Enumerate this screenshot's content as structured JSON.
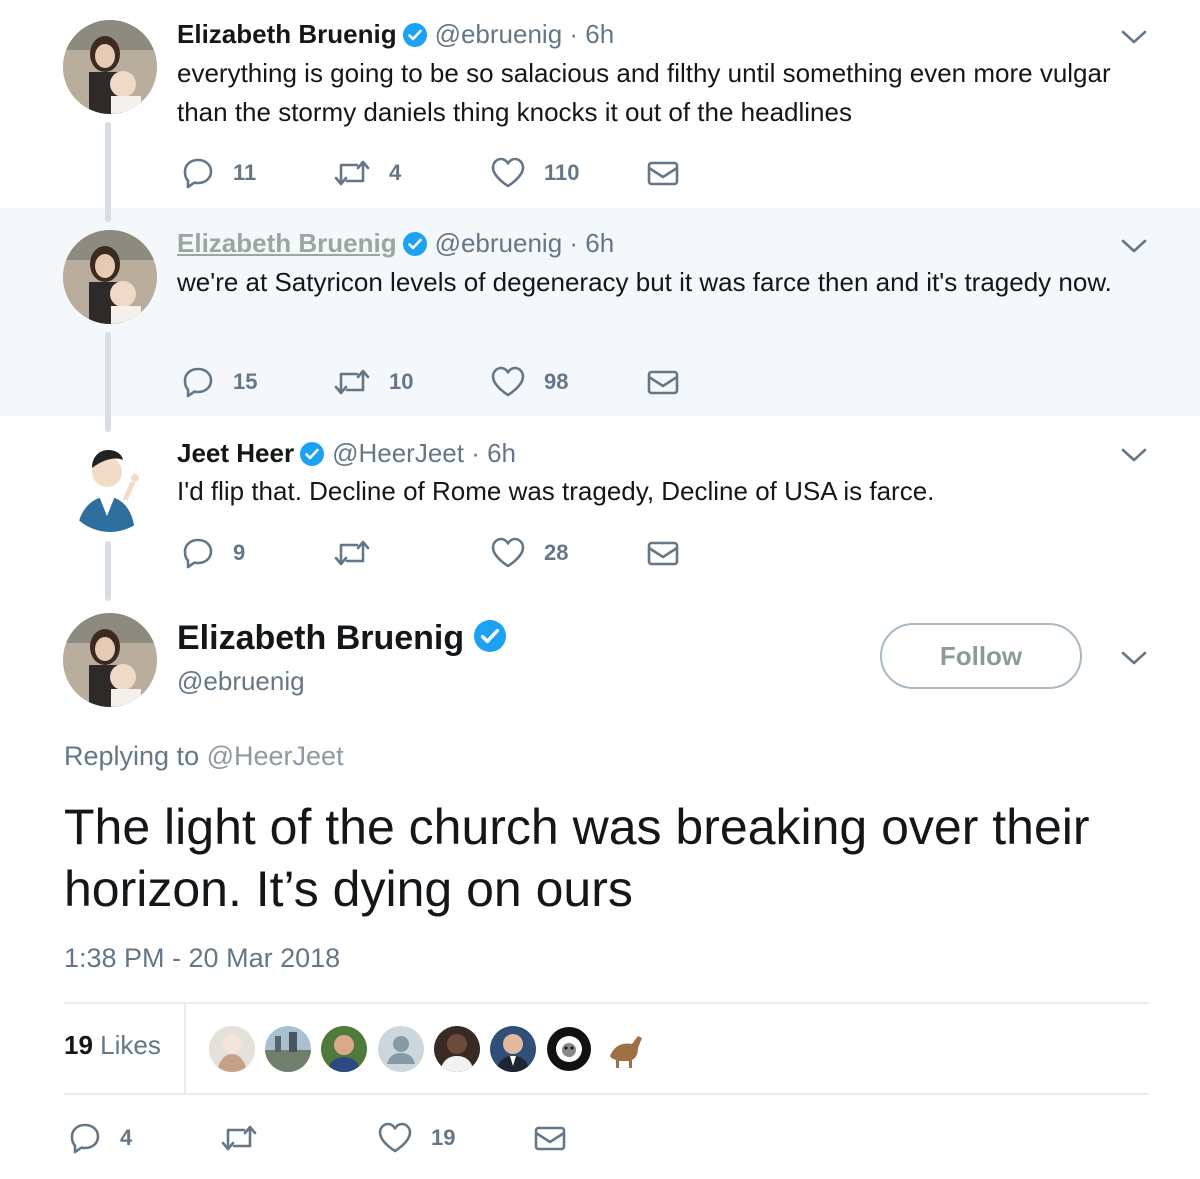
{
  "tweets": [
    {
      "name": "Elizabeth Bruenig",
      "handle": "@ebruenig",
      "time": "· 6h",
      "text": "everything is going to be so salacious and filthy until something even more vulgar than the stormy daniels thing knocks it out of the headlines",
      "replies": "11",
      "retweets": "4",
      "likes": "110"
    },
    {
      "name": "Elizabeth Bruenig",
      "handle": "@ebruenig",
      "time": "· 6h",
      "text": "we're at Satyricon levels of degeneracy but it was farce then and it's tragedy now.",
      "replies": "15",
      "retweets": "10",
      "likes": "98"
    },
    {
      "name": "Jeet Heer",
      "handle": "@HeerJeet",
      "time": "· 6h",
      "text": "I'd flip that. Decline of Rome was tragedy, Decline of USA is farce.",
      "replies": "9",
      "retweets": "",
      "likes": "28"
    }
  ],
  "focused": {
    "name": "Elizabeth Bruenig",
    "handle": "@ebruenig",
    "follow_label": "Follow",
    "replying_prefix": "Replying to",
    "replying_handle": "@HeerJeet",
    "text": "The light of the church was breaking over their horizon. It’s dying on ours",
    "timestamp": "1:38 PM - 20 Mar 2018",
    "likes_number": "19",
    "likes_word": "Likes",
    "replies": "4",
    "retweets": "",
    "likes": "19"
  },
  "colors": {
    "verified": "#1da1f2",
    "secondary_text": "#657786",
    "highlight_bg": "#f5f8fa"
  },
  "icons": [
    "reply-icon",
    "retweet-icon",
    "like-icon",
    "direct-message-icon",
    "chevron-down-icon",
    "verified-badge-icon"
  ]
}
